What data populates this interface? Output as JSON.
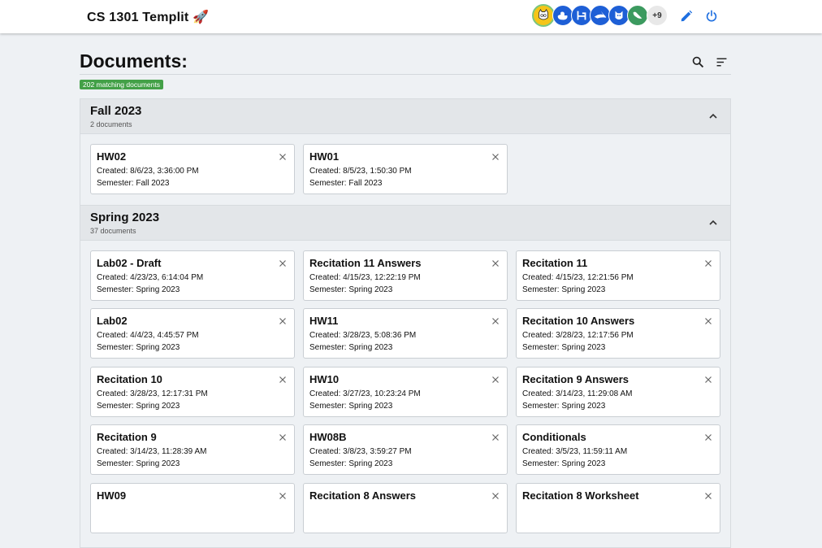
{
  "header": {
    "app_title": "CS 1301 Templit 🚀",
    "avatars": [
      {
        "icon": "cat-face-icon",
        "bg": "#f5c518",
        "ring": "#7bc67e"
      },
      {
        "icon": "duck-icon",
        "bg": "#1e5fd6",
        "ring": "#ffffff"
      },
      {
        "icon": "chair-icon",
        "bg": "#1e5fd6",
        "ring": "#ffffff"
      },
      {
        "icon": "shark-icon",
        "bg": "#1e5fd6",
        "ring": "#ffffff"
      },
      {
        "icon": "dog-icon",
        "bg": "#1e5fd6",
        "ring": "#ffffff"
      },
      {
        "icon": "bird-icon",
        "bg": "#3c9a5f",
        "ring": "#ffffff"
      }
    ],
    "more_users_label": "+9",
    "edit_icon": "pencil-icon",
    "power_icon": "power-icon",
    "accent_color": "#1e6fe0"
  },
  "main": {
    "heading": "Documents:",
    "match_badge": "202 matching documents",
    "search_icon": "search-icon",
    "sort_icon": "sort-icon"
  },
  "sections": [
    {
      "title": "Fall 2023",
      "count": "2 documents",
      "docs": [
        {
          "title": "HW02",
          "created": "Created: 8/6/23, 3:36:00 PM",
          "semester": "Semester: Fall 2023"
        },
        {
          "title": "HW01",
          "created": "Created: 8/5/23, 1:50:30 PM",
          "semester": "Semester: Fall 2023"
        }
      ]
    },
    {
      "title": "Spring 2023",
      "count": "37 documents",
      "docs": [
        {
          "title": "Lab02 - Draft",
          "created": "Created: 4/23/23, 6:14:04 PM",
          "semester": "Semester: Spring 2023"
        },
        {
          "title": "Recitation 11 Answers",
          "created": "Created: 4/15/23, 12:22:19 PM",
          "semester": "Semester: Spring 2023"
        },
        {
          "title": "Recitation 11",
          "created": "Created: 4/15/23, 12:21:56 PM",
          "semester": "Semester: Spring 2023"
        },
        {
          "title": "Lab02",
          "created": "Created: 4/4/23, 4:45:57 PM",
          "semester": "Semester: Spring 2023"
        },
        {
          "title": "HW11",
          "created": "Created: 3/28/23, 5:08:36 PM",
          "semester": "Semester: Spring 2023"
        },
        {
          "title": "Recitation 10 Answers",
          "created": "Created: 3/28/23, 12:17:56 PM",
          "semester": "Semester: Spring 2023"
        },
        {
          "title": "Recitation 10",
          "created": "Created: 3/28/23, 12:17:31 PM",
          "semester": "Semester: Spring 2023"
        },
        {
          "title": "HW10",
          "created": "Created: 3/27/23, 10:23:24 PM",
          "semester": "Semester: Spring 2023"
        },
        {
          "title": "Recitation 9 Answers",
          "created": "Created: 3/14/23, 11:29:08 AM",
          "semester": "Semester: Spring 2023"
        },
        {
          "title": "Recitation 9",
          "created": "Created: 3/14/23, 11:28:39 AM",
          "semester": "Semester: Spring 2023"
        },
        {
          "title": "HW08B",
          "created": "Created: 3/8/23, 3:59:27 PM",
          "semester": "Semester: Spring 2023"
        },
        {
          "title": "Conditionals",
          "created": "Created: 3/5/23, 11:59:11 AM",
          "semester": "Semester: Spring 2023"
        },
        {
          "title": "HW09",
          "created": "",
          "semester": ""
        },
        {
          "title": "Recitation 8 Answers",
          "created": "",
          "semester": ""
        },
        {
          "title": "Recitation 8 Worksheet",
          "created": "",
          "semester": ""
        }
      ]
    }
  ]
}
